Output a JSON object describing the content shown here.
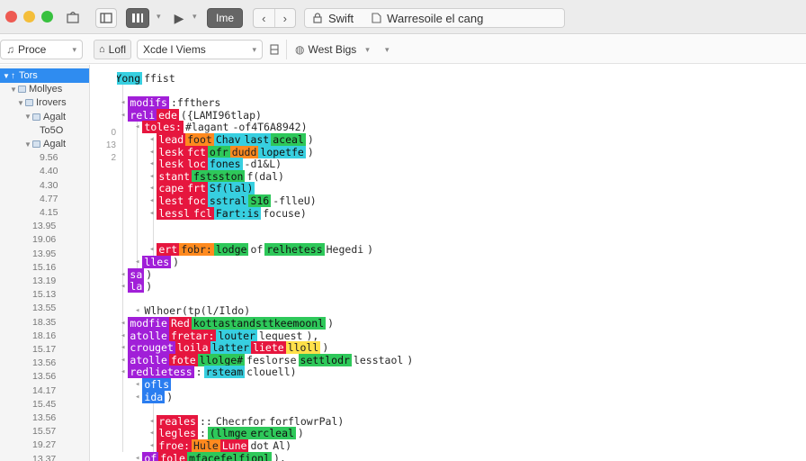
{
  "toolbar": {
    "scheme_button": "Ime",
    "activity": {
      "project": "Swift",
      "separator_icon": "file-icon",
      "status": "Warresoile el cang"
    }
  },
  "jumpbar": {
    "left_dropdown": "Proce",
    "left_chip": "Lofl",
    "middle_dropdown": "Xcde l Viems",
    "device": "West Bigs"
  },
  "sidebar": {
    "items": [
      {
        "label": "Tors",
        "selected": true,
        "indent": 0,
        "disclosure": "down"
      },
      {
        "label": "Mollyes",
        "indent": 1,
        "disclosure": "down",
        "icon": true
      },
      {
        "label": "Irovers",
        "indent": 2,
        "disclosure": "down",
        "icon": true
      },
      {
        "label": "Agalt",
        "indent": 3,
        "disclosure": "down",
        "icon": true
      },
      {
        "label": "To5O",
        "indent": 4
      },
      {
        "label": "Agalt",
        "indent": 3,
        "disclosure": "down",
        "icon": true
      },
      {
        "label": "9.56",
        "indent": 4
      },
      {
        "label": "4.40",
        "indent": 4
      },
      {
        "label": "4.30",
        "indent": 4
      },
      {
        "label": "4.77",
        "indent": 4
      },
      {
        "label": "4.15",
        "indent": 4
      },
      {
        "label": "13.95",
        "indent": 3
      },
      {
        "label": "19.06",
        "indent": 3
      },
      {
        "label": "13.95",
        "indent": 3
      },
      {
        "label": "15.16",
        "indent": 3
      },
      {
        "label": "13.19",
        "indent": 3
      },
      {
        "label": "15.13",
        "indent": 3
      },
      {
        "label": "13.55",
        "indent": 3
      },
      {
        "label": "18.35",
        "indent": 3
      },
      {
        "label": "18.16",
        "indent": 3
      },
      {
        "label": "15.17",
        "indent": 3
      },
      {
        "label": "13.56",
        "indent": 3
      },
      {
        "label": "13.56",
        "indent": 3
      },
      {
        "label": "14.17",
        "indent": 3
      },
      {
        "label": "15.45",
        "indent": 3
      },
      {
        "label": "13.56",
        "indent": 3
      },
      {
        "label": "15.57",
        "indent": 3
      },
      {
        "label": "19.27",
        "indent": 3
      },
      {
        "label": "13.37",
        "indent": 3
      }
    ]
  },
  "gutter": [
    "0",
    "13",
    "2"
  ],
  "code": [
    {
      "indent": 0,
      "segs": [
        [
          "c",
          "Yong"
        ],
        [
          "t",
          "ffist"
        ]
      ]
    },
    {
      "indent": 0,
      "segs": []
    },
    {
      "indent": 1,
      "segs": [
        [
          "p",
          "modifs"
        ],
        [
          "t",
          ":ffthers"
        ]
      ]
    },
    {
      "indent": 1,
      "segs": [
        [
          "p",
          "reli"
        ],
        [
          "r",
          "ede"
        ],
        [
          "t",
          "({LAMI96tlap)"
        ]
      ]
    },
    {
      "indent": 2,
      "segs": [
        [
          "r",
          "toles:"
        ],
        [
          "t",
          "#lagant"
        ],
        [
          "t",
          "-of4T6A8942)"
        ]
      ]
    },
    {
      "indent": 3,
      "segs": [
        [
          "r",
          "lead"
        ],
        [
          "o",
          "foot"
        ],
        [
          "c",
          "Chav"
        ],
        [
          "c",
          "last"
        ],
        [
          "g",
          "aceal"
        ],
        [
          "t",
          ")"
        ]
      ]
    },
    {
      "indent": 3,
      "segs": [
        [
          "r",
          "lesk"
        ],
        [
          "r",
          "fct"
        ],
        [
          "g",
          "ofr"
        ],
        [
          "o",
          "dudd"
        ],
        [
          "c",
          "lopetfe"
        ],
        [
          "t",
          ")"
        ]
      ]
    },
    {
      "indent": 3,
      "segs": [
        [
          "r",
          "lesk"
        ],
        [
          "r",
          "loc"
        ],
        [
          "c",
          "fones"
        ],
        [
          "t",
          "-d1&L)"
        ]
      ]
    },
    {
      "indent": 3,
      "segs": [
        [
          "r",
          "stant"
        ],
        [
          "g",
          "fstsston"
        ],
        [
          "t",
          "f(dal)"
        ]
      ]
    },
    {
      "indent": 3,
      "segs": [
        [
          "r",
          "cape"
        ],
        [
          "r",
          "frt"
        ],
        [
          "c",
          "Sf(lal)"
        ]
      ]
    },
    {
      "indent": 3,
      "segs": [
        [
          "r",
          "lest"
        ],
        [
          "r",
          "foc"
        ],
        [
          "c",
          "sstral"
        ],
        [
          "g",
          "S16"
        ],
        [
          "t",
          "-flleU)"
        ]
      ]
    },
    {
      "indent": 3,
      "segs": [
        [
          "r",
          "lessl"
        ],
        [
          "r",
          "fcl"
        ],
        [
          "c",
          "Fart:is"
        ],
        [
          "t",
          "focuse)"
        ]
      ]
    },
    {
      "indent": 0,
      "segs": []
    },
    {
      "indent": 0,
      "segs": []
    },
    {
      "indent": 3,
      "segs": [
        [
          "r",
          "ert"
        ],
        [
          "o",
          "fobr:"
        ],
        [
          "g",
          "lodge"
        ],
        [
          "t",
          "of"
        ],
        [
          "g",
          "relhetess"
        ],
        [
          "t",
          "Hegedi"
        ],
        [
          "t",
          ")"
        ]
      ]
    },
    {
      "indent": 2,
      "segs": [
        [
          "p",
          "lles"
        ],
        [
          "t",
          ")"
        ]
      ]
    },
    {
      "indent": 1,
      "segs": [
        [
          "p",
          "sa"
        ],
        [
          "t",
          ")"
        ]
      ]
    },
    {
      "indent": 1,
      "segs": [
        [
          "p",
          "la"
        ],
        [
          "t",
          ")"
        ]
      ]
    },
    {
      "indent": 0,
      "segs": []
    },
    {
      "indent": 2,
      "segs": [
        [
          "t",
          "Wlhoer(tp(l/Ildo)"
        ]
      ]
    },
    {
      "indent": 1,
      "segs": [
        [
          "p",
          "modfie"
        ],
        [
          "r",
          "Red"
        ],
        [
          "g",
          "kottastandsttkeemoonl"
        ],
        [
          "t",
          ")"
        ]
      ]
    },
    {
      "indent": 1,
      "segs": [
        [
          "p",
          "atolle"
        ],
        [
          "r",
          "fretar:"
        ],
        [
          "c",
          "louter"
        ],
        [
          "t",
          "lequest"
        ],
        [
          "t",
          "),"
        ]
      ]
    },
    {
      "indent": 1,
      "segs": [
        [
          "p",
          "crouget"
        ],
        [
          "r",
          "loila"
        ],
        [
          "c",
          "latter"
        ],
        [
          "r",
          "liete"
        ],
        [
          "y",
          "lloll"
        ],
        [
          "t",
          ")"
        ]
      ]
    },
    {
      "indent": 1,
      "segs": [
        [
          "p",
          "atolle"
        ],
        [
          "r",
          "fote"
        ],
        [
          "g",
          "llolge#"
        ],
        [
          "t",
          "feslorse"
        ],
        [
          "g",
          "settlodr"
        ],
        [
          "t",
          "lesstaol"
        ],
        [
          "t",
          ")"
        ]
      ]
    },
    {
      "indent": 1,
      "segs": [
        [
          "p",
          "redlietess"
        ],
        [
          "t",
          ":"
        ],
        [
          "c",
          "rsteam"
        ],
        [
          "t",
          "clouell)"
        ]
      ]
    },
    {
      "indent": 2,
      "segs": [
        [
          "b",
          "ofls"
        ]
      ]
    },
    {
      "indent": 2,
      "segs": [
        [
          "b",
          "ida"
        ],
        [
          "t",
          ")"
        ]
      ]
    },
    {
      "indent": 0,
      "segs": []
    },
    {
      "indent": 3,
      "segs": [
        [
          "r",
          "reales"
        ],
        [
          "t",
          "::"
        ],
        [
          "t",
          "Checrfor"
        ],
        [
          "t",
          "forflowrPal)"
        ]
      ]
    },
    {
      "indent": 3,
      "segs": [
        [
          "r",
          "legles"
        ],
        [
          "t",
          ":"
        ],
        [
          "g",
          "(llmge"
        ],
        [
          "g",
          "ercleal"
        ],
        [
          "t",
          ")"
        ]
      ]
    },
    {
      "indent": 3,
      "segs": [
        [
          "r",
          "froe:"
        ],
        [
          "o",
          "Hule"
        ],
        [
          "r",
          "Lune"
        ],
        [
          "t",
          "dot"
        ],
        [
          "t",
          "Al)"
        ]
      ]
    },
    {
      "indent": 2,
      "segs": [
        [
          "p",
          "of"
        ],
        [
          "r",
          "fole"
        ],
        [
          "g",
          "mfacefelfionl"
        ],
        [
          "t",
          "),"
        ]
      ]
    }
  ]
}
